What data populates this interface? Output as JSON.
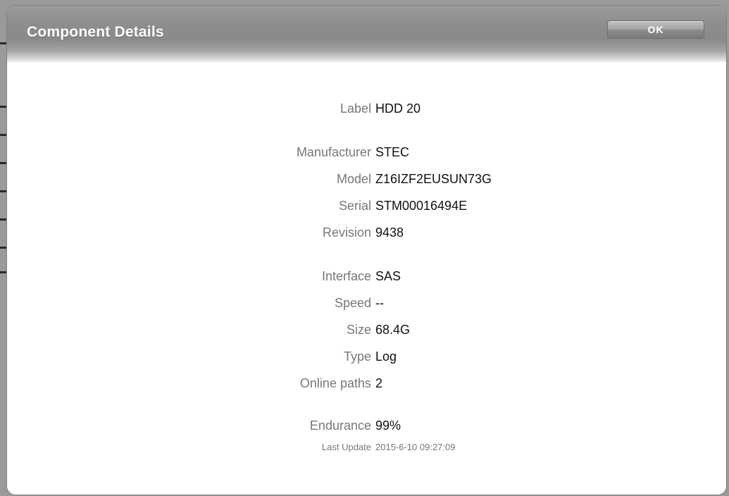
{
  "dialog": {
    "title": "Component Details",
    "ok_label": "OK"
  },
  "details": {
    "label": {
      "label": "Label",
      "value": "HDD 20"
    },
    "manufacturer": {
      "label": "Manufacturer",
      "value": "STEC"
    },
    "model": {
      "label": "Model",
      "value": "Z16IZF2EUSUN73G"
    },
    "serial": {
      "label": "Serial",
      "value": "STM00016494E"
    },
    "revision": {
      "label": "Revision",
      "value": "9438"
    },
    "interface": {
      "label": "Interface",
      "value": "SAS"
    },
    "speed": {
      "label": "Speed",
      "value": "--"
    },
    "size": {
      "label": "Size",
      "value": "68.4G"
    },
    "type": {
      "label": "Type",
      "value": "Log"
    },
    "online_paths": {
      "label": "Online paths",
      "value": "2"
    },
    "endurance": {
      "label": "Endurance",
      "value": "99%"
    },
    "last_update": {
      "label": "Last Update",
      "value": "2015-6-10 09:27:09"
    }
  },
  "colors": {
    "title_text": "#ffffff",
    "label_text": "#777777",
    "value_text": "#111111",
    "titlebar": "#8d8d8d"
  }
}
